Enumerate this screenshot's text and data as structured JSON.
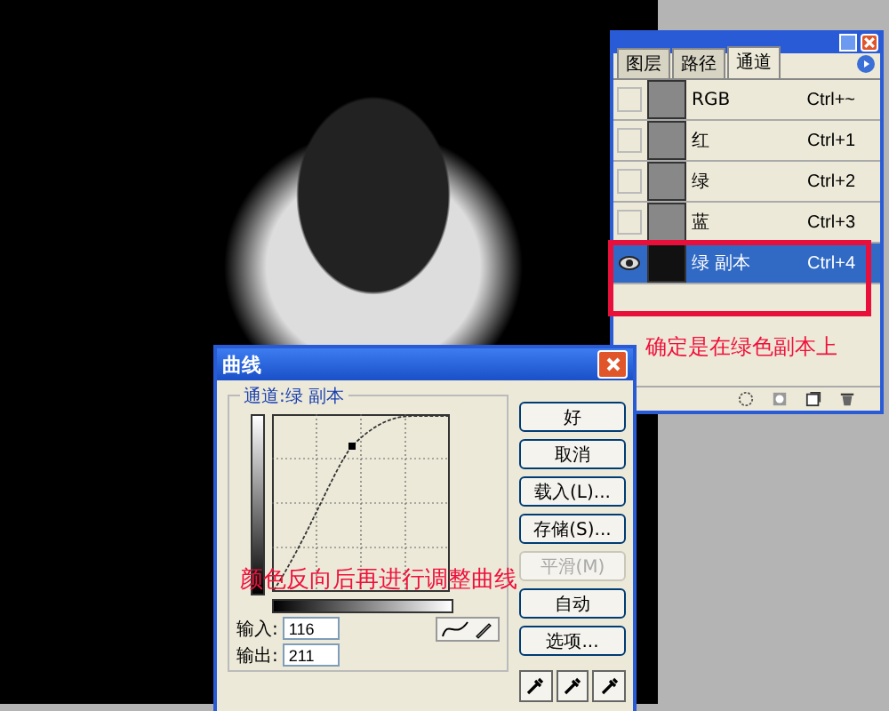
{
  "channels_panel": {
    "tabs": [
      {
        "label": "图层",
        "selected": false
      },
      {
        "label": "路径",
        "selected": false
      },
      {
        "label": "通道",
        "selected": true
      }
    ],
    "channels": [
      {
        "name": "RGB",
        "shortcut": "Ctrl+~",
        "visible": false,
        "selected": false
      },
      {
        "name": "红",
        "shortcut": "Ctrl+1",
        "visible": false,
        "selected": false
      },
      {
        "name": "绿",
        "shortcut": "Ctrl+2",
        "visible": false,
        "selected": false
      },
      {
        "name": "蓝",
        "shortcut": "Ctrl+3",
        "visible": false,
        "selected": false
      },
      {
        "name": "绿 副本",
        "shortcut": "Ctrl+4",
        "visible": true,
        "selected": true
      }
    ]
  },
  "annotations": [
    {
      "text": "确定是在绿色副本上"
    },
    {
      "text": "颜色反向后再进行调整曲线"
    }
  ],
  "curves_dialog": {
    "title": "曲线",
    "channel_label": "通道:绿 副本",
    "buttons": [
      {
        "label": "好",
        "disabled": false
      },
      {
        "label": "取消",
        "disabled": false
      },
      {
        "label": "载入(L)...",
        "disabled": false
      },
      {
        "label": "存储(S)...",
        "disabled": false
      },
      {
        "label": "平滑(M)",
        "disabled": true
      },
      {
        "label": "自动",
        "disabled": false
      },
      {
        "label": "选项...",
        "disabled": false
      }
    ],
    "input_label": "输入:",
    "input_value": "116",
    "output_label": "输出:",
    "output_value": "211"
  }
}
